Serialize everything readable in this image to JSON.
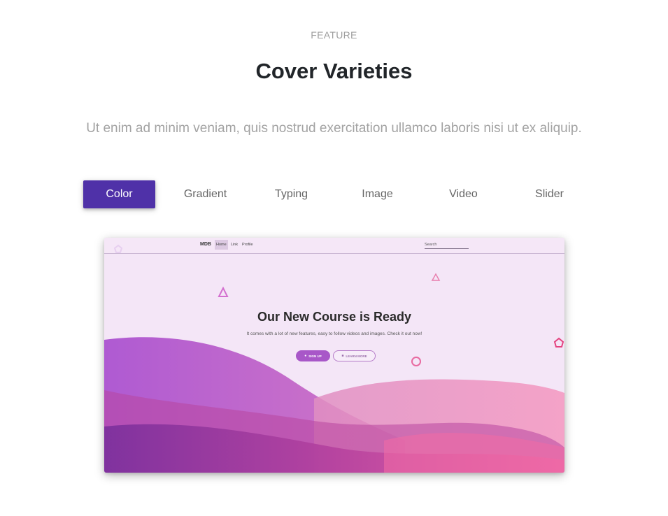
{
  "section": {
    "eyebrow": "FEATURE",
    "title": "Cover Varieties",
    "subtitle": "Ut enim ad minim veniam, quis nostrud exercitation ullamco laboris nisi ut ex aliquip."
  },
  "tabs": [
    {
      "label": "Color",
      "active": true
    },
    {
      "label": "Gradient",
      "active": false
    },
    {
      "label": "Typing",
      "active": false
    },
    {
      "label": "Image",
      "active": false
    },
    {
      "label": "Video",
      "active": false
    },
    {
      "label": "Slider",
      "active": false
    }
  ],
  "preview": {
    "navbar": {
      "brand": "MDB",
      "links": [
        "Home",
        "Link",
        "Profile"
      ],
      "active_link": "Home",
      "search_placeholder": "Search"
    },
    "hero": {
      "title": "Our New Course is Ready",
      "subtitle": "It comes with a lot of new features, easy to follow videos and images. Check it out now!",
      "primary_button": "SIGN UP",
      "primary_icon": "user-icon",
      "secondary_button": "LEARN MORE",
      "secondary_icon": "book-icon"
    }
  },
  "colors": {
    "accent": "#4f31a8",
    "preview_background": "#f4e6f7",
    "wave_purple": "#a94ecf",
    "wave_pink": "#ee6aa7"
  }
}
